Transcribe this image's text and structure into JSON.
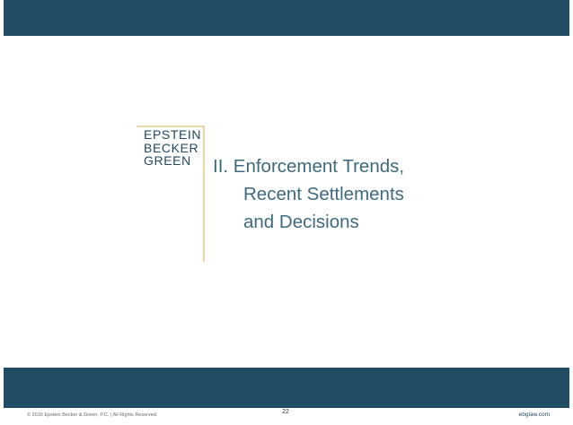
{
  "logo": {
    "lines": [
      "EPSTEIN",
      "BECKER",
      "GREEN"
    ]
  },
  "slide": {
    "title_lines": [
      "II. Enforcement Trends,",
      "Recent Settlements",
      "and Decisions"
    ]
  },
  "footer": {
    "copyright": "© 2016 Epstein Becker & Green, P.C. | All Rights Reserved.",
    "page_number": "22",
    "website": "ebglaw.com"
  },
  "colors": {
    "band": "#204c64",
    "title": "#3e6a80",
    "logo_rule": "#e6d7a4"
  }
}
